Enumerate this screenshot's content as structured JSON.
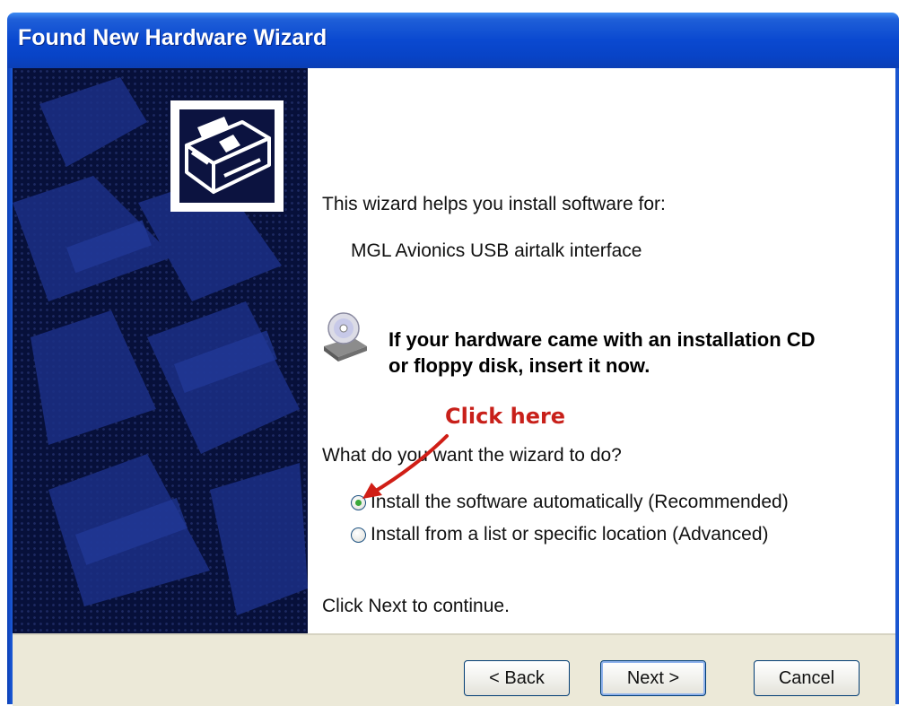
{
  "window": {
    "title": "Found New Hardware Wizard",
    "title_color": "#0a49d0"
  },
  "content": {
    "intro_text": "This wizard helps you install software for:",
    "device_name": "MGL Avionics USB airtalk interface",
    "cd_message_line1": "If your hardware came with an installation CD",
    "cd_message_line2": "or floppy disk, insert it now.",
    "question": "What do you want the wizard to do?",
    "options": [
      {
        "label": "Install the software automatically (Recommended)",
        "selected": true
      },
      {
        "label": "Install from a list or specific location (Advanced)",
        "selected": false
      }
    ],
    "continue_text": "Click Next to continue."
  },
  "annotation": {
    "text": "Click here",
    "color": "#c8201a"
  },
  "buttons": {
    "back_label": "< Back",
    "next_label": "Next >",
    "cancel_label": "Cancel"
  },
  "icons": {
    "side_icon": "hardware-install-icon",
    "cd_icon": "cd-drive-icon"
  }
}
